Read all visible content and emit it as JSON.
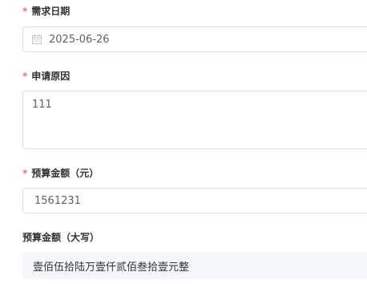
{
  "fields": {
    "demand_date": {
      "required_mark": "*",
      "label": "需求日期",
      "value": "2025-06-26",
      "icon": "calendar-icon"
    },
    "apply_reason": {
      "required_mark": "*",
      "label": "申请原因",
      "value": "111"
    },
    "budget_amount": {
      "required_mark": "*",
      "label": "预算金额（元）",
      "value": "1561231"
    },
    "budget_amount_upper": {
      "label": "预算金额（大写）",
      "value": "壹佰伍拾陆万壹仟贰佰叁拾壹元整"
    }
  },
  "colors": {
    "required": "#f56c6c",
    "border": "#dcdfe6",
    "readonly_bg": "#f5f7fa",
    "label_text": "#303133",
    "value_text": "#606266"
  }
}
